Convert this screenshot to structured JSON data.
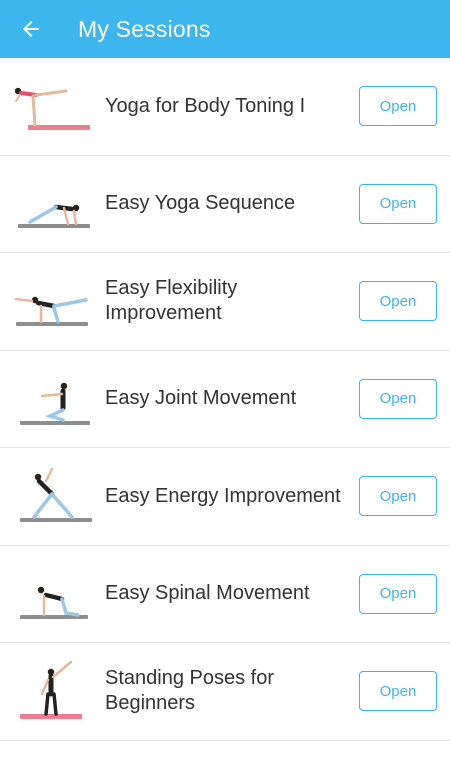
{
  "header": {
    "title": "My Sessions",
    "back_icon": "arrow-left-icon",
    "color": "#3db5ed"
  },
  "sessions": [
    {
      "title": "Yoga for Body Toning I",
      "button": "Open",
      "mat_color": "#f07d8f",
      "pose": "standing-split"
    },
    {
      "title": "Easy Yoga Sequence",
      "button": "Open",
      "mat_color": "#8e8e8e",
      "pose": "plank-twist"
    },
    {
      "title": "Easy Flexibility Improvement",
      "button": "Open",
      "mat_color": "#8e8e8e",
      "pose": "bird-dog"
    },
    {
      "title": "Easy Joint Movement",
      "button": "Open",
      "mat_color": "#8e8e8e",
      "pose": "kneeling-arms-forward"
    },
    {
      "title": "Easy Energy Improvement",
      "button": "Open",
      "mat_color": "#8e8e8e",
      "pose": "triangle"
    },
    {
      "title": "Easy Spinal Movement",
      "button": "Open",
      "mat_color": "#8e8e8e",
      "pose": "cat-cow"
    },
    {
      "title": "Standing Poses for Beginners",
      "button": "Open",
      "mat_color": "#f07d8f",
      "pose": "side-bend"
    }
  ]
}
